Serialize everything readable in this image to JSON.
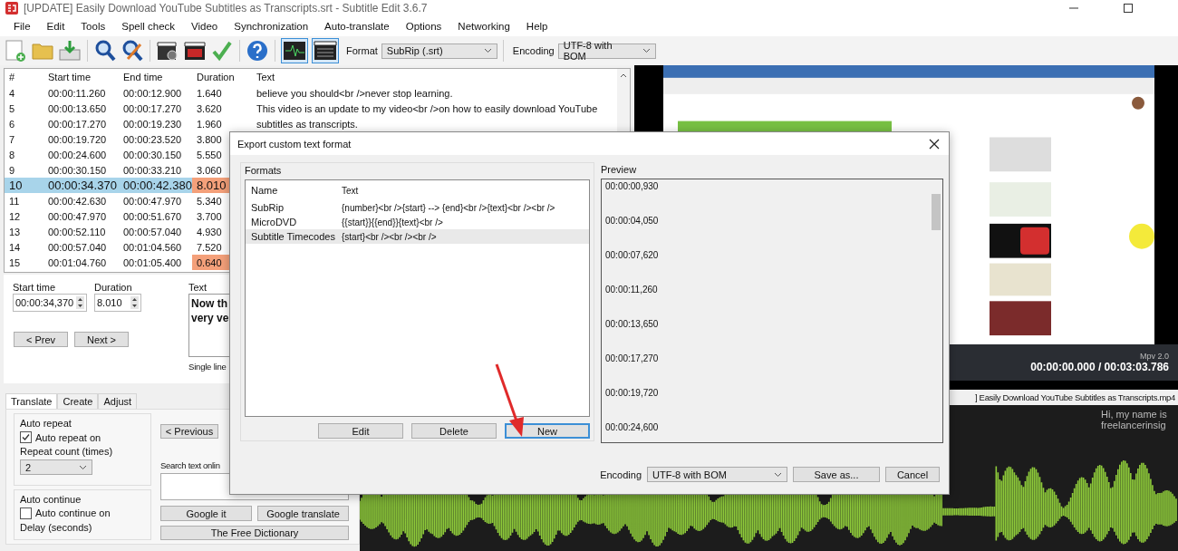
{
  "window": {
    "title": "[UPDATE] Easily Download YouTube Subtitles as Transcripts.srt - Subtitle Edit 3.6.7"
  },
  "menu": [
    "File",
    "Edit",
    "Tools",
    "Spell check",
    "Video",
    "Synchronization",
    "Auto-translate",
    "Options",
    "Networking",
    "Help"
  ],
  "toolbar": [
    {
      "kind": "new"
    },
    {
      "kind": "open"
    },
    {
      "kind": "download"
    },
    {
      "kind": "sep"
    },
    {
      "kind": "find"
    },
    {
      "kind": "replace"
    },
    {
      "kind": "sep"
    },
    {
      "kind": "clapper"
    },
    {
      "kind": "cc"
    },
    {
      "kind": "check"
    },
    {
      "kind": "sep"
    },
    {
      "kind": "help"
    },
    {
      "kind": "sep"
    }
  ],
  "toggles": [
    {
      "kind": "waveform",
      "selected": true
    },
    {
      "kind": "video",
      "selected": true
    }
  ],
  "format": {
    "label": "Format",
    "value": "SubRip (.srt)"
  },
  "encoding": {
    "label": "Encoding",
    "value": "UTF-8 with BOM"
  },
  "table": {
    "columns": [
      "#",
      "Start time",
      "End time",
      "Duration",
      "Text"
    ],
    "rows": [
      {
        "number": "4",
        "start": "00:00:11.260",
        "end": "00:00:12.900",
        "duration": "1.640",
        "text": "believe you should<br />never stop learning.",
        "selected": false,
        "warning": false
      },
      {
        "number": "5",
        "start": "00:00:13.650",
        "end": "00:00:17.270",
        "duration": "3.620",
        "text": "This video is an update to my video<br />on how to easily download YouTube",
        "selected": false,
        "warning": false
      },
      {
        "number": "6",
        "start": "00:00:17.270",
        "end": "00:00:19.230",
        "duration": "1.960",
        "text": "subtitles as transcripts.",
        "selected": false,
        "warning": false
      },
      {
        "number": "7",
        "start": "00:00:19.720",
        "end": "00:00:23.520",
        "duration": "3.800",
        "selected": false,
        "warning": false
      },
      {
        "number": "8",
        "start": "00:00:24.600",
        "end": "00:00:30.150",
        "duration": "5.550",
        "selected": false,
        "warning": false
      },
      {
        "number": "9",
        "start": "00:00:30.150",
        "end": "00:00:33.210",
        "duration": "3.060",
        "selected": false,
        "warning": false
      },
      {
        "number": "10",
        "start": "00:00:34.370",
        "end": "00:00:42.380",
        "duration": "8.010",
        "selected": true,
        "warning": true
      },
      {
        "number": "11",
        "start": "00:00:42.630",
        "end": "00:00:47.970",
        "duration": "5.340",
        "selected": false,
        "warning": false
      },
      {
        "number": "12",
        "start": "00:00:47.970",
        "end": "00:00:51.670",
        "duration": "3.700",
        "selected": false,
        "warning": false
      },
      {
        "number": "13",
        "start": "00:00:52.110",
        "end": "00:00:57.040",
        "duration": "4.930",
        "selected": false,
        "warning": false
      },
      {
        "number": "14",
        "start": "00:00:57.040",
        "end": "00:01:04.560",
        "duration": "7.520",
        "selected": false,
        "warning": false
      },
      {
        "number": "15",
        "start": "00:01:04.760",
        "end": "00:01:05.400",
        "duration": "0.640",
        "selected": false,
        "warning": true
      }
    ]
  },
  "edit": {
    "start_label": "Start time",
    "start_value": "00:00:34,370",
    "duration_label": "Duration",
    "duration_value": "8.010",
    "prev": "< Prev",
    "next": "Next >",
    "text_label": "Text",
    "text_lines": [
      "Now th",
      "very ve"
    ],
    "single_line": "Single line"
  },
  "bottom_tabs": [
    {
      "label": "Translate",
      "selected": true
    },
    {
      "label": "Create",
      "selected": false
    },
    {
      "label": "Adjust",
      "selected": false
    }
  ],
  "auto_repeat": {
    "title": "Auto repeat",
    "checkbox": {
      "label": "Auto repeat on",
      "checked": true
    },
    "count_label": "Repeat count (times)",
    "count_value": "2"
  },
  "auto_continue": {
    "title": "Auto continue",
    "checkbox": {
      "label": "Auto continue on",
      "checked": false
    },
    "delay_label": "Delay (seconds)"
  },
  "translate": {
    "previous": "< Previous",
    "search_label": "Search text onlin",
    "google_it": "Google it",
    "google_translate": "Google translate",
    "dictionary": "The Free Dictionary"
  },
  "video": {
    "player": "Mpv 2.0",
    "time": "00:00:00.000 / 00:03:03.786",
    "filename": "] Easily Download YouTube Subtitles as Transcripts.mp4"
  },
  "waveform": {
    "subtitle_lines": [
      "Hi, my name is",
      "freelancerinsig"
    ]
  },
  "dialog": {
    "title": "Export custom text format",
    "formats_label": "Formats",
    "columns": [
      "Name",
      "Text"
    ],
    "rows": [
      {
        "name": "SubRip",
        "text": "{number}<br />{start} --> {end}<br />{text}<br /><br />",
        "selected": false
      },
      {
        "name": "MicroDVD",
        "text": "{{start}}{{end}}{text}<br />",
        "selected": false
      },
      {
        "name": "Subtitle Timecodes",
        "text": "{start}<br /><br /><br />",
        "selected": true
      }
    ],
    "buttons": [
      {
        "label": "Edit",
        "focused": false
      },
      {
        "label": "Delete",
        "focused": false
      },
      {
        "label": "New",
        "focused": true
      }
    ],
    "preview_label": "Preview",
    "preview_lines": [
      "00:00:00,930",
      "00:00:04,050",
      "00:00:07,620",
      "00:00:11,260",
      "00:00:13,650",
      "00:00:17,270",
      "00:00:19,720",
      "00:00:24,600"
    ],
    "encoding_label": "Encoding",
    "encoding_value": "UTF-8 with BOM",
    "save": "Save as...",
    "cancel": "Cancel"
  }
}
